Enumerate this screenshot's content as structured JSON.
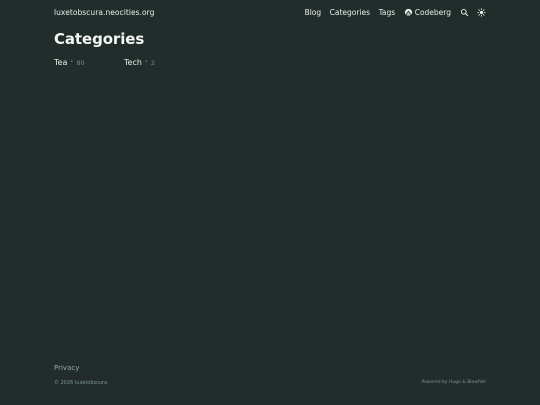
{
  "header": {
    "site_title": "luxetobscura.neocities.org",
    "nav": {
      "blog": "Blog",
      "categories": "Categories",
      "tags": "Tags",
      "codeberg": "Codeberg"
    }
  },
  "main": {
    "title": "Categories",
    "categories": [
      {
        "name": "Tea",
        "separator": "•",
        "count": "80"
      },
      {
        "name": "Tech",
        "separator": "•",
        "count": "2"
      }
    ]
  },
  "footer": {
    "privacy": "Privacy",
    "copyright": "© 2026 luxetobscura",
    "powered_by": "Powered by Hugo & Blowfish"
  },
  "icons": {
    "codeberg": "codeberg-icon",
    "search": "search-icon",
    "appearance": "sun-icon"
  },
  "colors": {
    "background": "#222d2b",
    "text": "#e7eeec",
    "muted": "#7b9591"
  }
}
